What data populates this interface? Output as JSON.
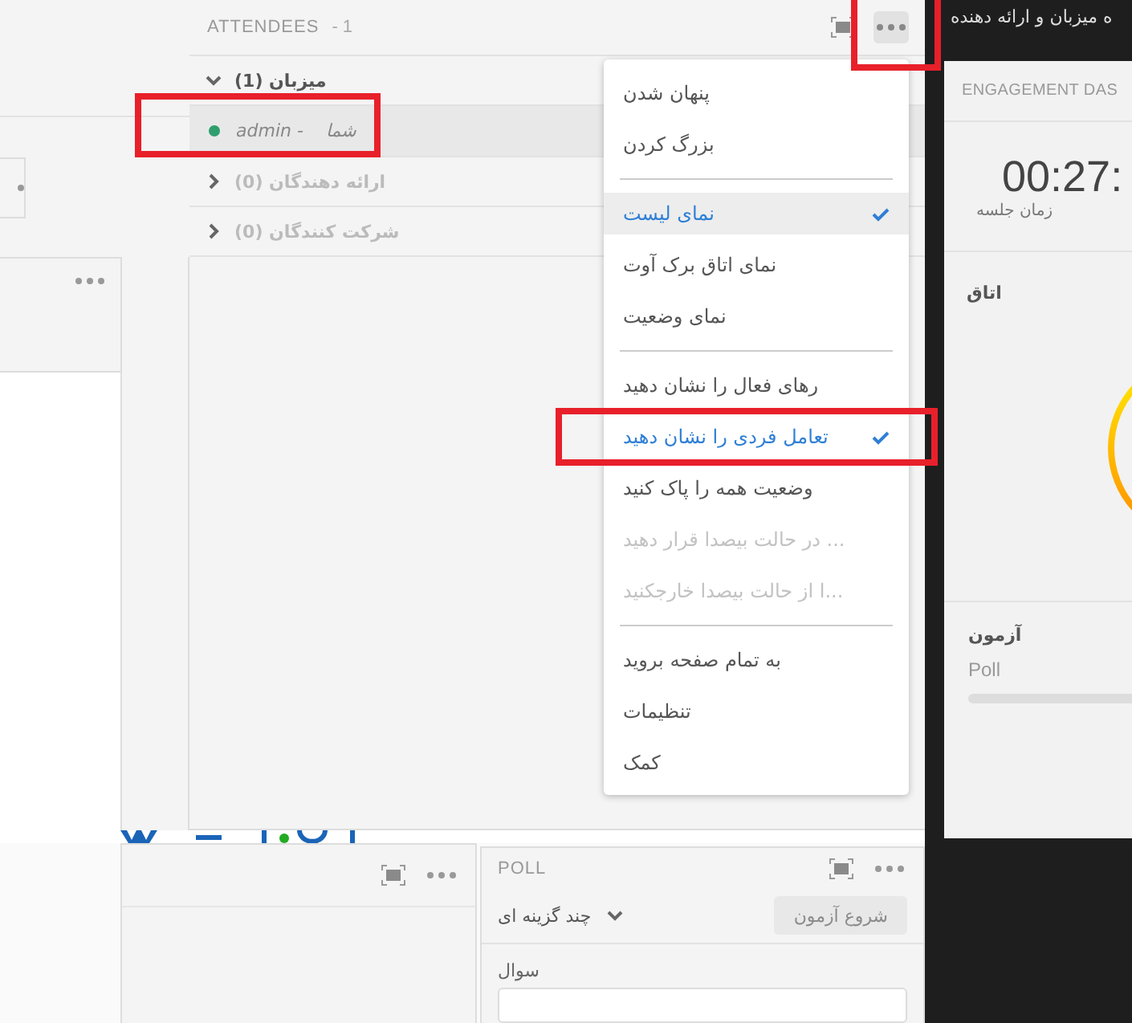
{
  "attendees": {
    "title": "ATTENDEES",
    "count": "- 1",
    "groups": [
      {
        "label": "میزبان (1)",
        "expanded": true,
        "members": [
          {
            "name": "admin - ",
            "tag": "شما",
            "color": "#2e9e6e",
            "highlighted": true
          }
        ]
      },
      {
        "label": "ارائه دهندگان (0)",
        "expanded": false
      },
      {
        "label": "شرکت کنندگان (0)",
        "expanded": false
      }
    ]
  },
  "options_menu": {
    "items": [
      {
        "kind": "item",
        "label": "پنهان شدن",
        "checked": false,
        "highlighted": false,
        "disabled": false
      },
      {
        "kind": "item",
        "label": "بزرگ کردن",
        "checked": false,
        "highlighted": false,
        "disabled": false
      },
      {
        "kind": "divider"
      },
      {
        "kind": "item",
        "label": "نمای لیست",
        "checked": true,
        "highlighted": true,
        "disabled": false
      },
      {
        "kind": "item",
        "label": "نمای اتاق برک آوت",
        "checked": false,
        "highlighted": false,
        "disabled": false
      },
      {
        "kind": "item",
        "label": "نمای وضعیت",
        "checked": false,
        "highlighted": false,
        "disabled": false
      },
      {
        "kind": "divider"
      },
      {
        "kind": "item",
        "label": "رهای فعال را نشان دهید",
        "checked": false,
        "highlighted": false,
        "disabled": false
      },
      {
        "kind": "item",
        "label": "تعامل فردی را نشان دهید",
        "checked": true,
        "highlighted": false,
        "disabled": false
      },
      {
        "kind": "item",
        "label": "وضعیت همه را پاک کنید",
        "checked": false,
        "highlighted": false,
        "disabled": false
      },
      {
        "kind": "item",
        "label": "... در حالت بیصدا قرار دهید",
        "checked": false,
        "highlighted": false,
        "disabled": true
      },
      {
        "kind": "item",
        "label": "...ا از حالت بیصدا خارجکنید",
        "checked": false,
        "highlighted": false,
        "disabled": true
      },
      {
        "kind": "divider"
      },
      {
        "kind": "item",
        "label": "به تمام صفحه بروید",
        "checked": false,
        "highlighted": false,
        "disabled": false
      },
      {
        "kind": "item",
        "label": "تنظیمات",
        "checked": false,
        "highlighted": false,
        "disabled": false
      },
      {
        "kind": "item",
        "label": "کمک",
        "checked": false,
        "highlighted": false,
        "disabled": false
      }
    ]
  },
  "top_bar_text": "ه میزبان و ارائه دهنده",
  "engagement": {
    "title": "ENGAGEMENT DAS",
    "timer": "00:27:",
    "timer_label": "زمان جلسه",
    "room_label": "اتاق",
    "poll_title": "آزمون",
    "poll_subtitle": "Poll"
  },
  "poll": {
    "title": "POLL",
    "type_select": "چند گزینه ای",
    "start_button": {
      "label": "شروع آزمون",
      "disabled": true
    },
    "question_label": "سوال"
  }
}
